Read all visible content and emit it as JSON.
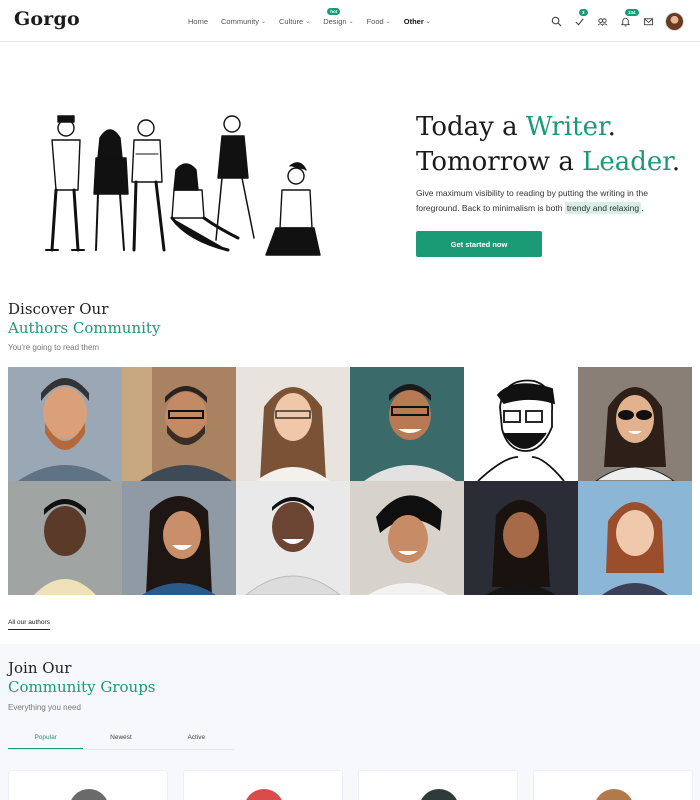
{
  "header": {
    "logo": "Gorgo",
    "nav": [
      {
        "label": "Home",
        "has_dropdown": false
      },
      {
        "label": "Community",
        "has_dropdown": true
      },
      {
        "label": "Culture",
        "has_dropdown": true
      },
      {
        "label": "Design",
        "has_dropdown": true,
        "badge": "hot"
      },
      {
        "label": "Food",
        "has_dropdown": true
      },
      {
        "label": "Other",
        "has_dropdown": true,
        "active": true
      }
    ],
    "icons": [
      {
        "name": "search-icon"
      },
      {
        "name": "check-icon",
        "badge": "3"
      },
      {
        "name": "group-icon"
      },
      {
        "name": "bell-icon",
        "badge": "134"
      },
      {
        "name": "mail-icon"
      }
    ],
    "dropdown_glyph": "⌄"
  },
  "hero": {
    "title_line1_pre": "Today a ",
    "title_line1_accent": "Writer",
    "title_line1_post": ".",
    "title_line2_pre": "Tomorrow a ",
    "title_line2_accent": "Leader",
    "title_line2_post": ".",
    "desc_pre": "Give maximum visibility to reading by putting the writing in the foreground. Back to minimalism is both ",
    "desc_highlight": "trendy and relaxing",
    "desc_post": ".",
    "cta": "Get started now"
  },
  "authors_section": {
    "title_line1": "Discover Our",
    "title_line2": "Authors Community",
    "subtitle": "You're going to read them",
    "all_link": "All our authors"
  },
  "community_section": {
    "title_line1": "Join Our",
    "title_line2": "Community Groups",
    "subtitle": "Everything you need",
    "tabs": [
      {
        "label": "Popular",
        "active": true
      },
      {
        "label": "Newest",
        "active": false
      },
      {
        "label": "Active",
        "active": false
      }
    ]
  },
  "colors": {
    "accent": "#1a9b75",
    "text": "#222222"
  }
}
